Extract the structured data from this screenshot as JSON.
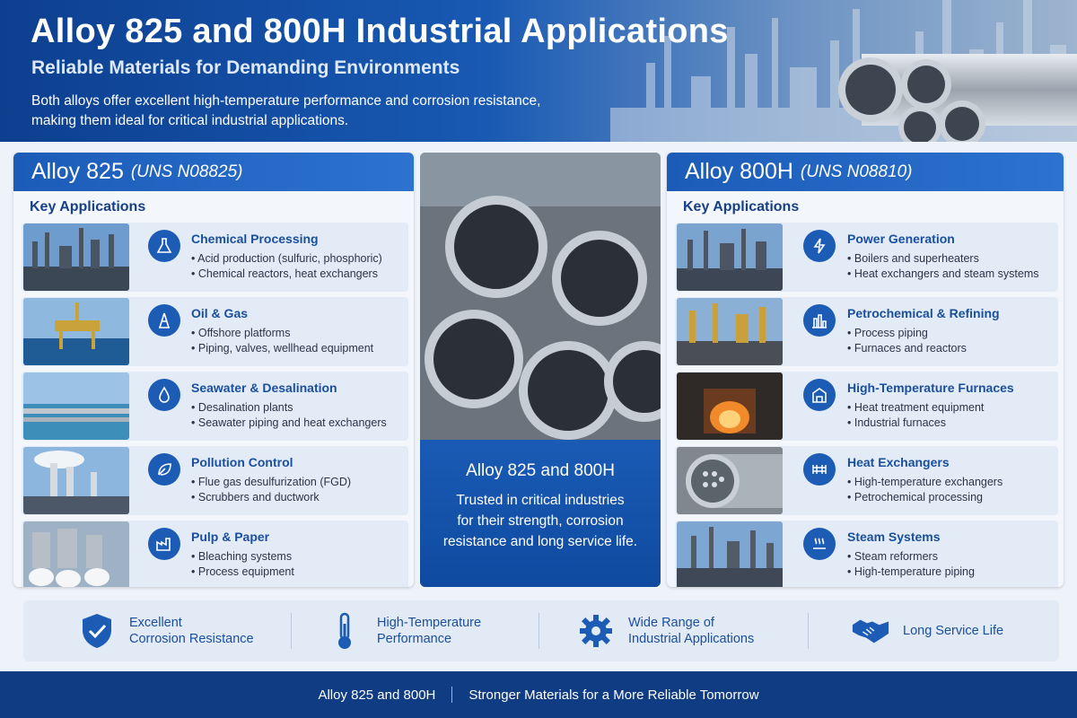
{
  "header": {
    "title": "Alloy 825 and 800H Industrial Applications",
    "subtitle": "Reliable Materials for Demanding Environments",
    "description_line1": "Both alloys offer excellent high-temperature performance and corrosion resistance,",
    "description_line2": "making them ideal for critical industrial applications."
  },
  "left_panel": {
    "alloy": "Alloy 825",
    "uns": "(UNS N08825)",
    "section_title": "Key Applications",
    "items": [
      {
        "title": "Chemical Processing",
        "bullets": [
          "Acid production (sulfuric, phosphoric)",
          "Chemical reactors, heat exchangers"
        ],
        "icon": "flask-icon"
      },
      {
        "title": "Oil & Gas",
        "bullets": [
          "Offshore platforms",
          "Piping, valves, wellhead equipment"
        ],
        "icon": "oil-rig-icon"
      },
      {
        "title": "Seawater & Desalination",
        "bullets": [
          "Desalination plants",
          "Seawater piping and heat exchangers"
        ],
        "icon": "water-drop-icon"
      },
      {
        "title": "Pollution Control",
        "bullets": [
          "Flue gas desulfurization (FGD)",
          "Scrubbers and ductwork"
        ],
        "icon": "leaf-icon"
      },
      {
        "title": "Pulp & Paper",
        "bullets": [
          "Bleaching systems",
          "Process equipment"
        ],
        "icon": "factory-icon"
      }
    ]
  },
  "center": {
    "title": "Alloy 825 and 800H",
    "text_line1": "Trusted in critical industries",
    "text_line2": "for their strength, corrosion",
    "text_line3": "resistance and long service life."
  },
  "right_panel": {
    "alloy": "Alloy 800H",
    "uns": "(UNS N08810)",
    "section_title": "Key Applications",
    "items": [
      {
        "title": "Power Generation",
        "bullets": [
          "Boilers and superheaters",
          "Heat exchangers and steam systems"
        ],
        "icon": "lightning-icon"
      },
      {
        "title": "Petrochemical & Refining",
        "bullets": [
          "Process piping",
          "Furnaces and reactors"
        ],
        "icon": "refinery-icon"
      },
      {
        "title": "High-Temperature Furnaces",
        "bullets": [
          "Heat treatment equipment",
          "Industrial furnaces"
        ],
        "icon": "furnace-icon"
      },
      {
        "title": "Heat Exchangers",
        "bullets": [
          "High-temperature exchangers",
          "Petrochemical processing"
        ],
        "icon": "heat-exchanger-icon"
      },
      {
        "title": "Steam Systems",
        "bullets": [
          "Steam reformers",
          "High-temperature piping"
        ],
        "icon": "steam-icon"
      }
    ]
  },
  "features": [
    {
      "line1": "Excellent",
      "line2": "Corrosion Resistance",
      "icon": "shield-check-icon"
    },
    {
      "line1": "High-Temperature",
      "line2": "Performance",
      "icon": "thermometer-icon"
    },
    {
      "line1": "Wide Range of",
      "line2": "Industrial Applications",
      "icon": "gear-icon"
    },
    {
      "line1": "Long Service Life",
      "line2": "",
      "icon": "handshake-icon"
    }
  ],
  "footer": {
    "left": "Alloy 825 and 800H",
    "right": "Stronger Materials for a More Reliable Tomorrow"
  },
  "colors": {
    "brand_blue": "#1b5cb8",
    "dark_blue": "#0f3c82",
    "panel_bg": "#f3f7fc",
    "card_bg": "#e3ebf6"
  }
}
